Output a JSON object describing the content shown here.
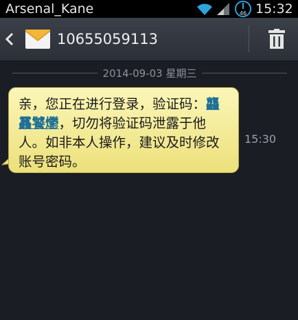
{
  "status_bar": {
    "carrier": "Arsenal_Kane",
    "time": "15:32",
    "clock_badge": "46"
  },
  "header": {
    "contact": "10655059113"
  },
  "thread": {
    "date_separator": "2014-09-03 星期三",
    "messages": [
      {
        "text_before": "亲，您正在进行登录，验证码：",
        "code": "龘靐饕爩",
        "text_after": "，切勿将验证码泄露于他人。如非本人操作，建议及时修改账号密码。",
        "time": "15:30"
      }
    ]
  },
  "colors": {
    "background": "#1a1d24",
    "header": "#33373f",
    "bubble": "#f6ee9c",
    "link": "#1f6f96"
  }
}
